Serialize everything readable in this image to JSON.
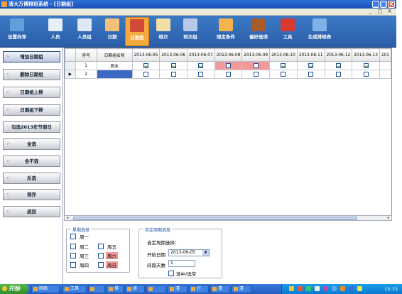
{
  "window": {
    "title": "清大万博排班系统 - [日期组]",
    "min": "_",
    "max": "□",
    "close": "X",
    "mdi_controls": "_ □ X"
  },
  "toolbar": [
    {
      "id": "guide",
      "label": "设置向导",
      "color": "#5fa0d8"
    },
    {
      "id": "staff",
      "label": "人员",
      "color": "#e8eef6"
    },
    {
      "id": "staffgroup",
      "label": "人员组",
      "color": "#dfe8f4"
    },
    {
      "id": "date",
      "label": "日期",
      "color": "#f3c07a"
    },
    {
      "id": "dategroup",
      "label": "日期组",
      "color": "#d04a3a"
    },
    {
      "id": "shift",
      "label": "班次",
      "color": "#f0e0a8"
    },
    {
      "id": "shiftgroup",
      "label": "班次组",
      "color": "#b8c8e8"
    },
    {
      "id": "limit",
      "label": "限定条件",
      "color": "#f5b34c"
    },
    {
      "id": "pref",
      "label": "偏好选项",
      "color": "#a85c2a"
    },
    {
      "id": "tools",
      "label": "工具",
      "color": "#d83a32"
    },
    {
      "id": "generate",
      "label": "生成排班表",
      "color": "#7fb3e6"
    }
  ],
  "sidebar": [
    {
      "label": "增加日期组",
      "arrow": "›",
      "selected": true
    },
    {
      "label": "删除日期组",
      "arrow": "›",
      "selected": false
    },
    {
      "label": "日期组上移",
      "arrow": "›",
      "selected": false
    },
    {
      "label": "日期组下移",
      "arrow": "›",
      "selected": false
    },
    {
      "label": "勾选2013年节假日",
      "arrow": "",
      "selected": false
    },
    {
      "label": "全选",
      "arrow": "›",
      "selected": false
    },
    {
      "label": "全不选",
      "arrow": "›",
      "selected": false
    },
    {
      "label": "反选",
      "arrow": "›",
      "selected": false
    },
    {
      "label": "保存",
      "arrow": "›",
      "selected": false
    },
    {
      "label": "返回",
      "arrow": "›",
      "selected": false
    }
  ],
  "grid": {
    "headers": [
      "序号",
      "日期组名称",
      "2013-06-05",
      "2013-06-06",
      "2013-06-07",
      "2013-06-08",
      "2013-06-09",
      "2013-06-10",
      "2013-06-11",
      "2013-06-12",
      "2013-06-13",
      "201"
    ],
    "rows": [
      {
        "current": false,
        "num": "1",
        "name": "周末",
        "checks": [
          true,
          true,
          true,
          false,
          false,
          true,
          true,
          true,
          true,
          false
        ]
      },
      {
        "current": true,
        "num": "2",
        "name": "",
        "checks": [
          false,
          false,
          false,
          false,
          false,
          false,
          false,
          false,
          false,
          false
        ]
      }
    ],
    "pink_cols": [
      3,
      4
    ],
    "row_marker": "▶"
  },
  "weekpanel": {
    "title": "星期选择",
    "days": [
      {
        "label": "周一",
        "pink": false
      },
      {
        "label": "周二",
        "pink": false
      },
      {
        "label": "周三",
        "pink": false
      },
      {
        "label": "周四",
        "pink": false
      },
      {
        "label": "周五",
        "pink": false
      },
      {
        "label": "周六",
        "pink": true
      },
      {
        "label": "周日",
        "pink": true
      }
    ]
  },
  "cyclepanel": {
    "title": "自定周期选择",
    "subtitle": "自定周期选择：",
    "start_label": "开始日期",
    "start_value": "2013-06-05",
    "interval_label": "间隔天数",
    "interval_value": "1",
    "toggle_label": "选中/选空"
  },
  "taskbar": {
    "start": "开始",
    "items": [
      "网络",
      "工具",
      "",
      "排",
      "排",
      "",
      "清",
      "打",
      "清",
      "清"
    ],
    "clock": "15:15"
  }
}
